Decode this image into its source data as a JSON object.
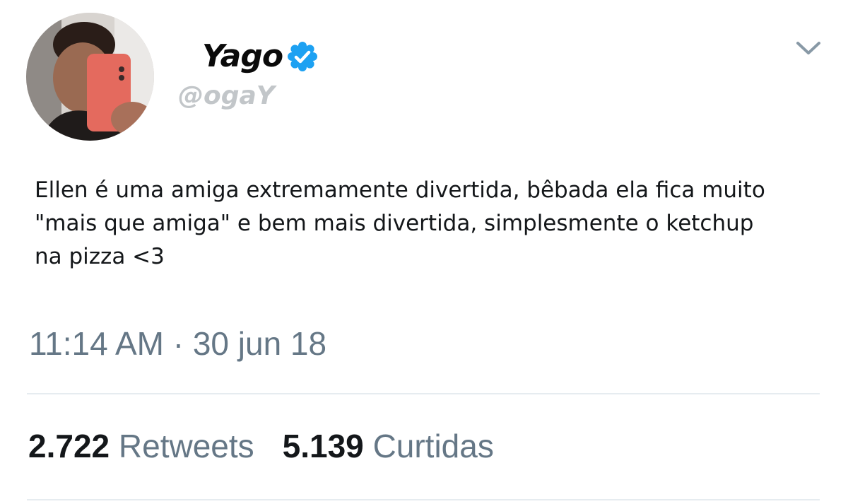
{
  "author": {
    "display_name": "Yago",
    "handle": "@ogaY",
    "verified": true
  },
  "tweet": {
    "lines": [
      "Ellen é uma amiga extremamente divertida, bêbada ela fica muito",
      "\"mais que amiga\" e bem mais divertida, simplesmente o ketchup",
      "na pizza <3"
    ],
    "timestamp": "11:14 AM · 30 jun 18"
  },
  "stats": {
    "retweets_count": "2.722",
    "retweets_label": "Retweets",
    "likes_count": "5.139",
    "likes_label": "Curtidas"
  },
  "icons": {
    "verified": "verified-badge-icon",
    "menu": "chevron-down-icon"
  },
  "colors": {
    "verified_blue": "#1da1f2",
    "muted_gray": "#657786",
    "divider": "#e6ecf0"
  }
}
